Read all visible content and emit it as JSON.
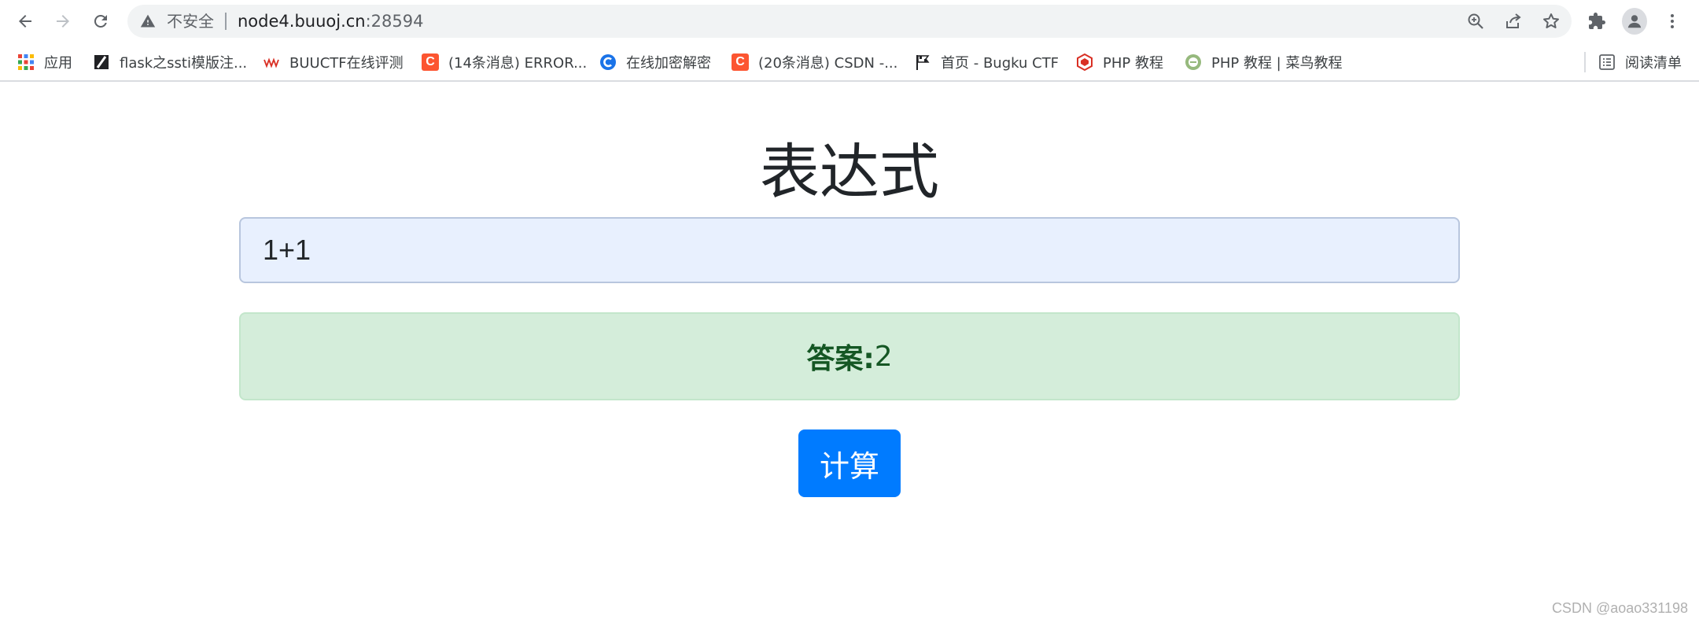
{
  "browser": {
    "address_bar": {
      "security_label": "不安全",
      "url_host": "node4.buuoj.cn",
      "url_port": ":28594"
    },
    "icons": {
      "back": "arrow-left-icon",
      "forward": "arrow-right-icon",
      "reload": "reload-icon",
      "warning": "warning-triangle-icon",
      "zoom": "zoom-in-icon",
      "share": "share-icon",
      "star": "star-icon",
      "extensions": "puzzle-icon",
      "profile": "avatar-icon",
      "menu": "kebab-menu-icon"
    }
  },
  "bookmarks": {
    "apps_label": "应用",
    "items": [
      {
        "label": "flask之ssti模版注...",
        "icon": "flask-icon"
      },
      {
        "label": "BUUCTF在线评测",
        "icon": "buuctf-icon"
      },
      {
        "label": "(14条消息) ERROR...",
        "icon": "csdn-icon"
      },
      {
        "label": "在线加密解密",
        "icon": "crypto-icon"
      },
      {
        "label": "(20条消息) CSDN -...",
        "icon": "csdn-icon"
      },
      {
        "label": "首页 - Bugku CTF",
        "icon": "flag-icon"
      },
      {
        "label": "PHP 教程",
        "icon": "php-icon"
      },
      {
        "label": "PHP 教程 | 菜鸟教程",
        "icon": "runoob-icon"
      }
    ],
    "reading_list_label": "阅读清单"
  },
  "page": {
    "title": "表达式",
    "expression_value": "1+1",
    "answer_label": "答案:",
    "answer_value": "2",
    "submit_label": "计算",
    "watermark": "CSDN @aoao331198"
  },
  "colors": {
    "input_bg": "#e8f0fe",
    "alert_bg": "#d4edda",
    "alert_text": "#155724",
    "button_bg": "#007bff"
  }
}
